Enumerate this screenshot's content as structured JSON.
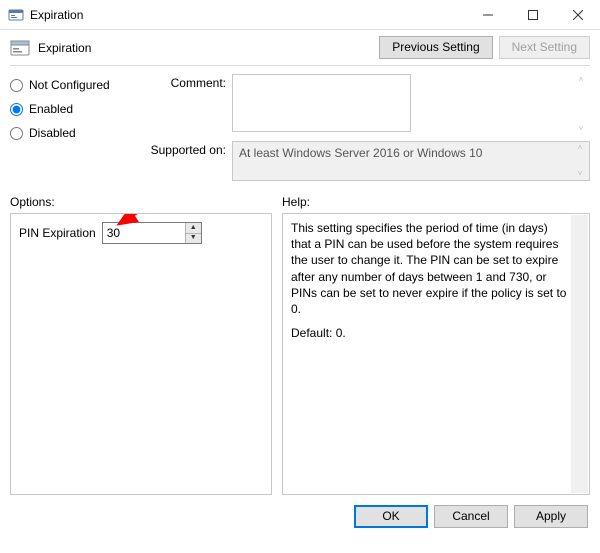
{
  "window": {
    "title": "Expiration"
  },
  "header": {
    "title": "Expiration",
    "prev_label": "Previous Setting",
    "next_label": "Next Setting"
  },
  "state": {
    "not_configured_label": "Not Configured",
    "enabled_label": "Enabled",
    "disabled_label": "Disabled",
    "selected": "enabled"
  },
  "fields": {
    "comment_label": "Comment:",
    "comment_value": "",
    "supported_label": "Supported on:",
    "supported_value": "At least Windows Server 2016 or Windows 10"
  },
  "options": {
    "section_label": "Options:",
    "pin_expiration_label": "PIN Expiration",
    "pin_expiration_value": "30"
  },
  "help": {
    "section_label": "Help:",
    "body": "This setting specifies the period of time (in days) that a PIN can be used before the system requires the user to change it. The PIN can be set to expire after any number of days between 1 and 730, or PINs can be set to never expire if the policy is set to 0.",
    "default_line": "Default: 0."
  },
  "footer": {
    "ok": "OK",
    "cancel": "Cancel",
    "apply": "Apply"
  }
}
